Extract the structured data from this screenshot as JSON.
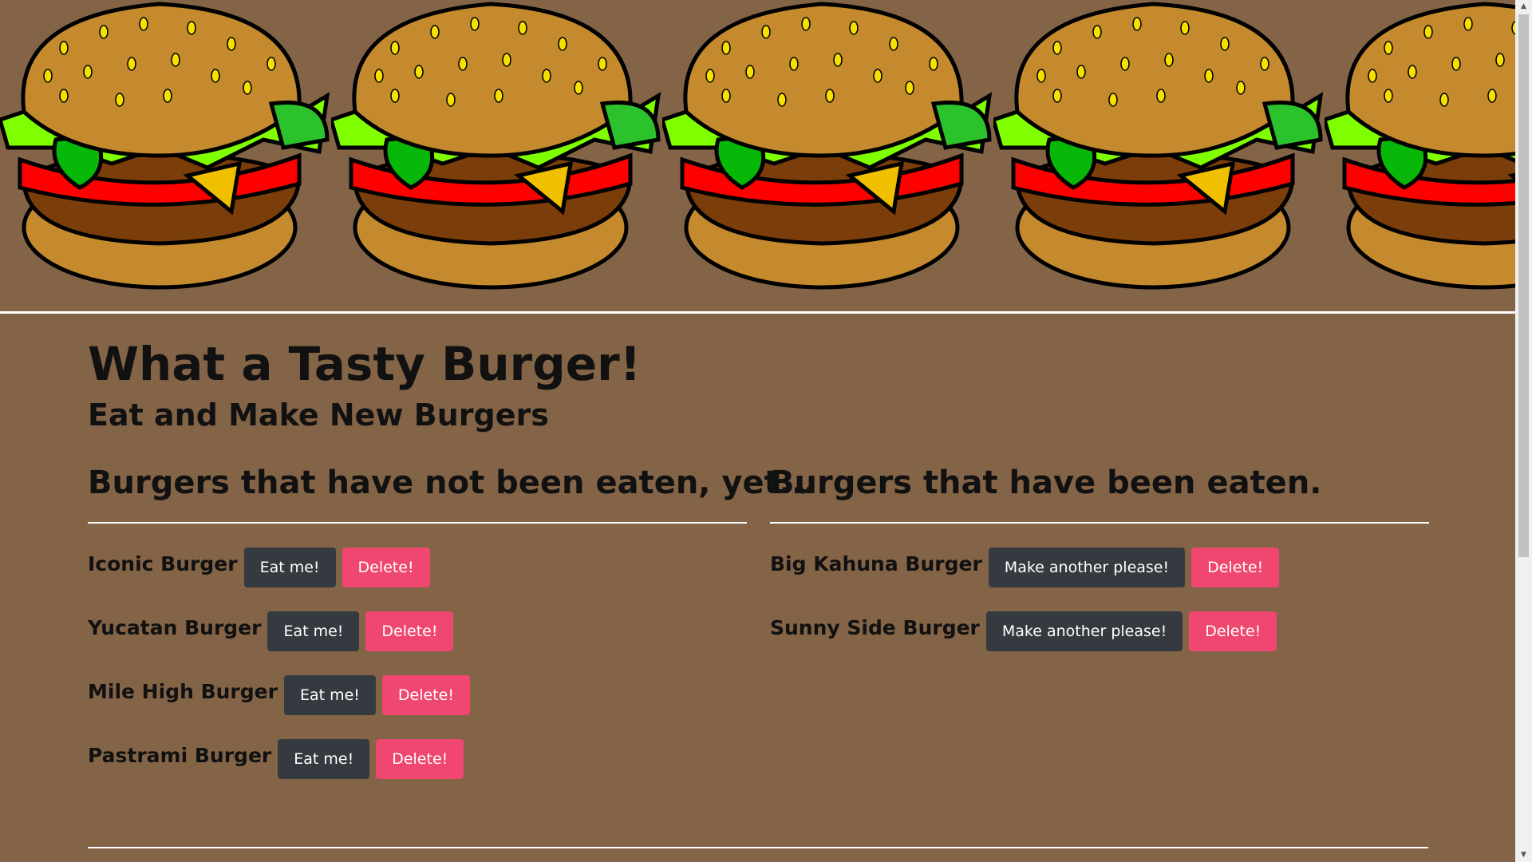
{
  "page": {
    "title": "What a Tasty Burger!",
    "subtitle": "Eat and Make New Burgers"
  },
  "uneaten": {
    "heading": "Burgers that have not been eaten, yet...",
    "items": [
      {
        "name": "Iconic Burger",
        "eat_label": "Eat me!",
        "delete_label": "Delete!"
      },
      {
        "name": "Yucatan Burger",
        "eat_label": "Eat me!",
        "delete_label": "Delete!"
      },
      {
        "name": "Mile High Burger",
        "eat_label": "Eat me!",
        "delete_label": "Delete!"
      },
      {
        "name": "Pastrami Burger",
        "eat_label": "Eat me!",
        "delete_label": "Delete!"
      }
    ]
  },
  "eaten": {
    "heading": "Burgers that have been eaten.",
    "items": [
      {
        "name": "Big Kahuna Burger",
        "remake_label": "Make another please!",
        "delete_label": "Delete!"
      },
      {
        "name": "Sunny Side Burger",
        "remake_label": "Make another please!",
        "delete_label": "Delete!"
      }
    ]
  },
  "colors": {
    "background": "#846447",
    "dark_button": "#343a40",
    "delete_button": "#ef476f",
    "rule": "#ffffff"
  },
  "icons": {
    "banner": "burger-illustration"
  }
}
